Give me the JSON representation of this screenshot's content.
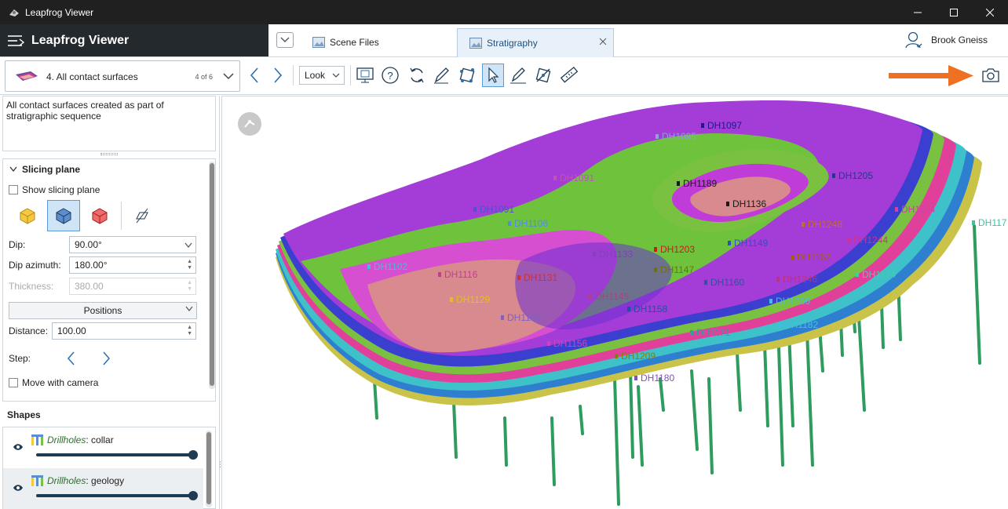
{
  "window": {
    "title": "Leapfrog Viewer"
  },
  "header": {
    "app_name": "Leapfrog Viewer",
    "tabs": [
      {
        "label": "Scene Files"
      },
      {
        "label": "Stratigraphy"
      }
    ],
    "user_name": "Brook Gneiss"
  },
  "toolbar": {
    "scene_label": "4. All contact surfaces",
    "scene_count": "4 of 6",
    "look_label": "Look"
  },
  "left_panel": {
    "description": "All contact surfaces created as part of stratigraphic sequence",
    "section_title": "Slicing plane",
    "show_slicing_plane": "Show slicing plane",
    "dip_label": "Dip:",
    "dip_value": "90.00°",
    "dip_azimuth_label": "Dip azimuth:",
    "dip_azimuth_value": "180.00°",
    "thickness_label": "Thickness:",
    "thickness_value": "380.00",
    "positions_label": "Positions",
    "distance_label": "Distance:",
    "distance_value": "100.00",
    "step_label": "Step:",
    "move_with_camera": "Move with camera"
  },
  "shapes": {
    "title": "Shapes",
    "items": [
      {
        "prefix": "Drillholes",
        "suffix": ": collar",
        "opacity": 1.0
      },
      {
        "prefix": "Drillholes",
        "suffix": ": geology",
        "opacity": 1.0
      }
    ]
  },
  "viewport": {
    "drillhole_labels": [
      {
        "text": "DH1097",
        "color": "#1a1a8c"
      },
      {
        "text": "DH1095",
        "color": "#8fa0d8"
      },
      {
        "text": "DH1205",
        "color": "#1f3b8c"
      },
      {
        "text": "DH1091",
        "color": "#c050c0"
      },
      {
        "text": "DH1189",
        "color": "#1a1a1a"
      },
      {
        "text": "DH1091",
        "color": "#5050d0"
      },
      {
        "text": "DH1136",
        "color": "#1a1a1a"
      },
      {
        "text": "DH1164",
        "color": "#d040a0"
      },
      {
        "text": "DH117",
        "color": "#40c0a0"
      },
      {
        "text": "DH1106",
        "color": "#4f8fd8"
      },
      {
        "text": "DH1248",
        "color": "#c07020"
      },
      {
        "text": "DH1244",
        "color": "#d03090"
      },
      {
        "text": "DH1203",
        "color": "#c02020"
      },
      {
        "text": "DH1149",
        "color": "#3050c0"
      },
      {
        "text": "DH1133",
        "color": "#8040c0"
      },
      {
        "text": "DH1162",
        "color": "#a06010"
      },
      {
        "text": "DH1102",
        "color": "#40c0d0"
      },
      {
        "text": "DH1147",
        "color": "#707010"
      },
      {
        "text": "DH1174",
        "color": "#40d0a0"
      },
      {
        "text": "DH1116",
        "color": "#c04090"
      },
      {
        "text": "DH1131",
        "color": "#d03030"
      },
      {
        "text": "DH1160",
        "color": "#3050a0"
      },
      {
        "text": "DH1246",
        "color": "#c03080"
      },
      {
        "text": "DH1129",
        "color": "#e0c020"
      },
      {
        "text": "DH1145",
        "color": "#b04080"
      },
      {
        "text": "DH1158",
        "color": "#2050a0"
      },
      {
        "text": "DH1250",
        "color": "#40c0e0"
      },
      {
        "text": "DH1142",
        "color": "#8060c0"
      },
      {
        "text": "DH1182",
        "color": "#40c0e0"
      },
      {
        "text": "DH1171",
        "color": "#30a0a0"
      },
      {
        "text": "DH1156",
        "color": "#d040c0"
      },
      {
        "text": "DH1209",
        "color": "#808010"
      },
      {
        "text": "DH1180",
        "color": "#8050c0"
      }
    ]
  },
  "colors": {
    "accent": "#1e6fb5",
    "annotation_arrow": "#ee7023"
  }
}
